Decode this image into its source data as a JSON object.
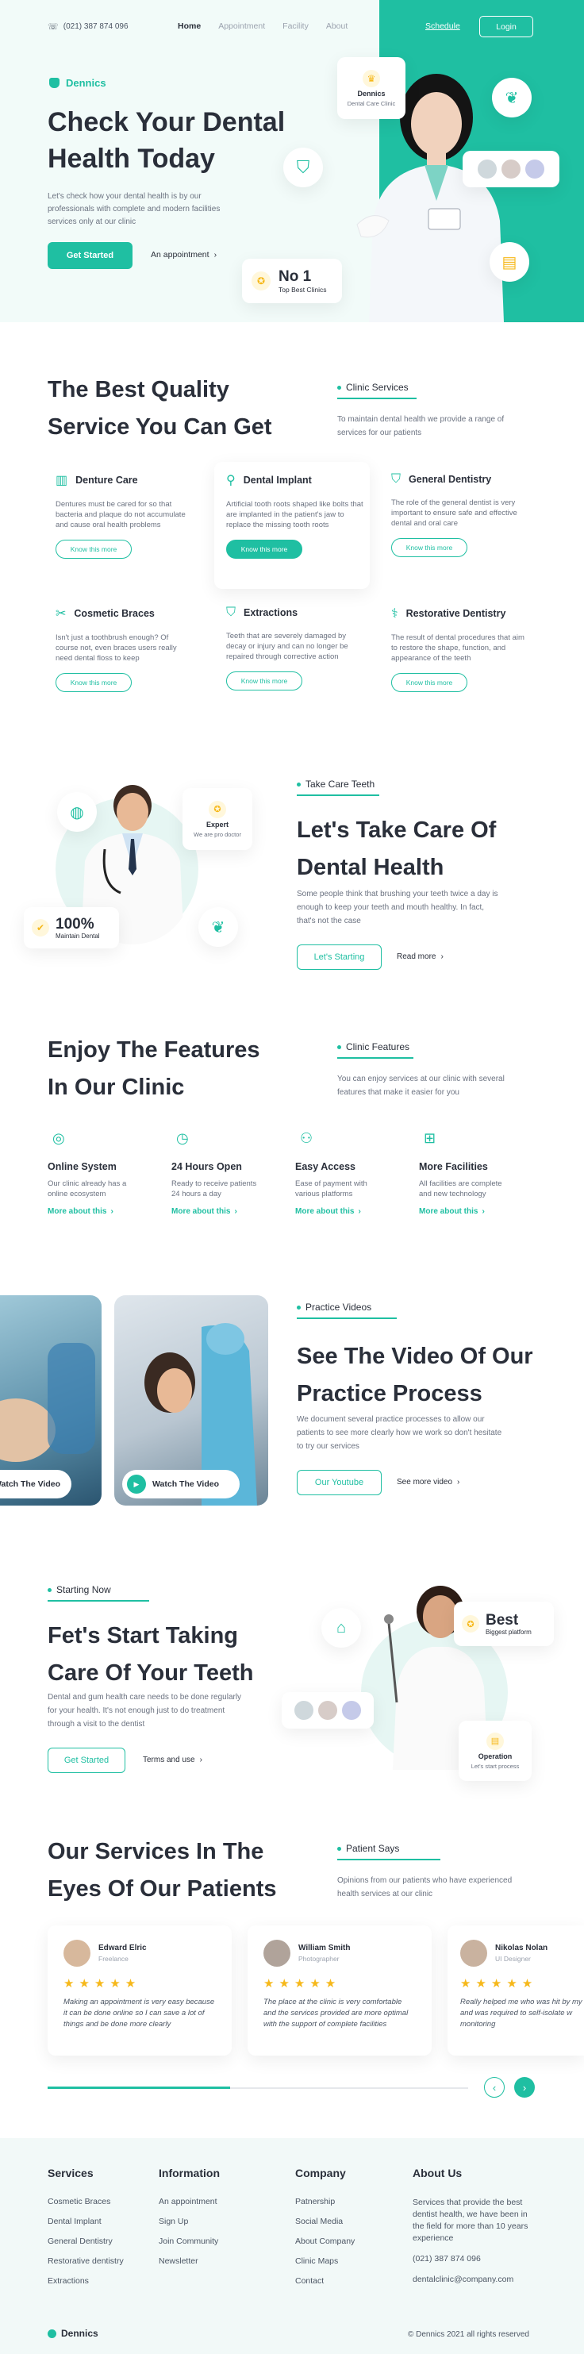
{
  "nav": {
    "phone": "(021) 387 874 096",
    "links": [
      "Home",
      "Appointment",
      "Facility",
      "About"
    ],
    "schedule": "Schedule",
    "login": "Login"
  },
  "brand": {
    "name": "Dennics"
  },
  "hero": {
    "title_line1": "Check Your Dental",
    "title_line2": "Health Today",
    "desc": "Let's check how your dental health is by our professionals with complete and modern facilities services only at our clinic",
    "cta": "Get Started",
    "appointment": "An appointment",
    "clinic_card_title": "Dennics",
    "clinic_card_sub": "Dental Care Clinic",
    "badge_title": "No 1",
    "badge_sub": "Top Best Clinics"
  },
  "services": {
    "title_line1": "The Best Quality",
    "title_line2": "Service You Can Get",
    "tag": "Clinic Services",
    "desc": "To maintain dental health we provide a range of services for our patients",
    "items": [
      {
        "title": "Denture Care",
        "text": "Dentures must be cared for so that bacteria and plaque do not accumulate and cause oral health problems",
        "btn": "Know this more"
      },
      {
        "title": "Dental Implant",
        "text": "Artificial tooth roots shaped like bolts that are implanted in the patient's jaw to replace the missing tooth roots",
        "btn": "Know this more"
      },
      {
        "title": "General Dentistry",
        "text": "The role of the general dentist is very important to ensure safe and effective dental and oral care",
        "btn": "Know this more"
      },
      {
        "title": "Cosmetic Braces",
        "text": "Isn't just a toothbrush enough? Of course not, even braces users really need dental floss to keep",
        "btn": "Know this more"
      },
      {
        "title": "Extractions",
        "text": "Teeth that are severely damaged by decay or injury and can no longer be repaired through corrective action",
        "btn": "Know this more"
      },
      {
        "title": "Restorative Dentistry",
        "text": "The result of dental procedures that aim to restore the shape, function, and appearance of the teeth",
        "btn": "Know this more"
      }
    ]
  },
  "care": {
    "tag": "Take Care Teeth",
    "title_line1": "Let's Take Care Of",
    "title_line2": "Dental Health",
    "desc": "Some people think that brushing your teeth twice a day is enough to keep your teeth and mouth healthy. In fact, that's not the case",
    "cta": "Let's Starting",
    "more": "Read more",
    "expert_title": "Expert",
    "expert_sub": "We are pro doctor",
    "stat_value": "100%",
    "stat_label": "Maintain Dental"
  },
  "features": {
    "title_line1": "Enjoy The Features",
    "title_line2": "In Our Clinic",
    "tag": "Clinic Features",
    "desc": "You can enjoy services at our clinic with several features that make it easier for you",
    "items": [
      {
        "title": "Online System",
        "text": "Our clinic already has a online ecosystem",
        "link": "More about this"
      },
      {
        "title": "24 Hours Open",
        "text": "Ready to receive patients 24 hours a day",
        "link": "More about this"
      },
      {
        "title": "Easy Access",
        "text": "Ease of payment with various platforms",
        "link": "More about this"
      },
      {
        "title": "More Facilities",
        "text": "All facilities are complete and new technology",
        "link": "More about this"
      }
    ]
  },
  "videos": {
    "tag": "Practice Videos",
    "title_line1": "See The Video Of Our",
    "title_line2": "Practice Process",
    "desc": "We document several practice processes to allow our patients to see more clearly how we work so don't hesitate to try our services",
    "cta": "Our Youtube",
    "more": "See more video",
    "watch1": "Watch The Video",
    "watch2": "Watch The Video"
  },
  "start": {
    "tag": "Starting Now",
    "title_line1": "Fet's Start Taking",
    "title_line2": "Care Of Your Teeth",
    "desc": "Dental and gum health care needs to be done regularly for your health. It's not enough just to do treatment through a visit to the dentist",
    "cta": "Get Started",
    "terms": "Terms and use",
    "best_title": "Best",
    "best_sub": "Biggest platform",
    "op_title": "Operation",
    "op_sub": "Let's start process"
  },
  "testimonials": {
    "title_line1": "Our Services In The",
    "title_line2": "Eyes Of Our Patients",
    "tag": "Patient Says",
    "desc": "Opinions from our patients who have experienced health services at our clinic",
    "items": [
      {
        "name": "Edward Elric",
        "role": "Freelance",
        "text": "Making an appointment is very easy because it can be done online so I can save a lot of things and be done more clearly"
      },
      {
        "name": "William Smith",
        "role": "Photographer",
        "text": "The place at the clinic is very comfortable and the services provided are more optimal with the support of complete facilities"
      },
      {
        "name": "Nikolas Nolan",
        "role": "UI Designer",
        "text": "Really helped me who was hit by my and was required to self-isolate w monitoring"
      }
    ]
  },
  "footer": {
    "cols": [
      {
        "title": "Services",
        "links": [
          "Cosmetic Braces",
          "Dental Implant",
          "General Dentistry",
          "Restorative dentistry",
          "Extractions"
        ]
      },
      {
        "title": "Information",
        "links": [
          "An appointment",
          "Sign Up",
          "Join Community",
          "Newsletter"
        ]
      },
      {
        "title": "Company",
        "links": [
          "Patnership",
          "Social Media",
          "About Company",
          "Clinic Maps",
          "Contact"
        ]
      }
    ],
    "about_title": "About Us",
    "about_text": "Services that provide the best dentist health, we have been in the field for more than 10 years experience",
    "about_phone": "(021) 387 874 096",
    "about_email": "dentalclinic@company.com",
    "brand": "Dennics",
    "copyright": "© Dennics 2021 all rights reserved"
  },
  "colors": {
    "accent": "#1fbfa2",
    "text": "#2a2f3a",
    "muted": "#6b7280",
    "star": "#f6b81a"
  }
}
